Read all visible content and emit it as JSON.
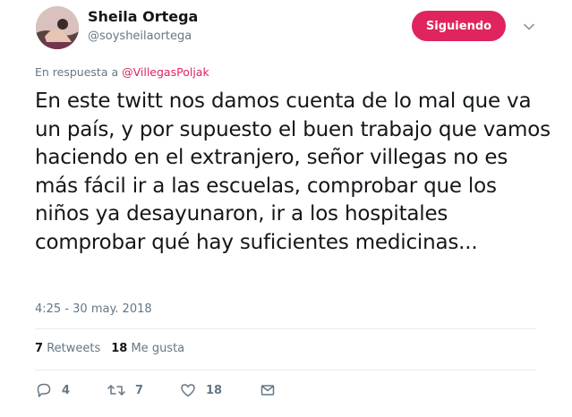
{
  "author": {
    "name": "Sheila Ortega",
    "handle": "@soysheilaortega",
    "follow_label": "Siguiendo"
  },
  "reply_to": {
    "prefix": "En respuesta a",
    "mention": "@VillegasPoljak"
  },
  "tweet": {
    "text": "En este twitt nos damos cuenta de lo mal que va un país, y por supuesto el buen trabajo que vamos haciendo en el extranjero, señor villegas no es más fácil ir a las escuelas, comprobar que los niños ya desayunaron, ir a los hospitales comprobar qué hay suficientes medicinas...",
    "timestamp": "4:25 - 30 may. 2018"
  },
  "stats": {
    "retweets_count": "7",
    "retweets_label": "Retweets",
    "likes_count": "18",
    "likes_label": "Me gusta"
  },
  "actions": {
    "reply_count": "4",
    "retweet_count": "7",
    "like_count": "18"
  },
  "colors": {
    "accent": "#e0245e",
    "muted": "#657786",
    "divider": "#e6ecf0"
  }
}
